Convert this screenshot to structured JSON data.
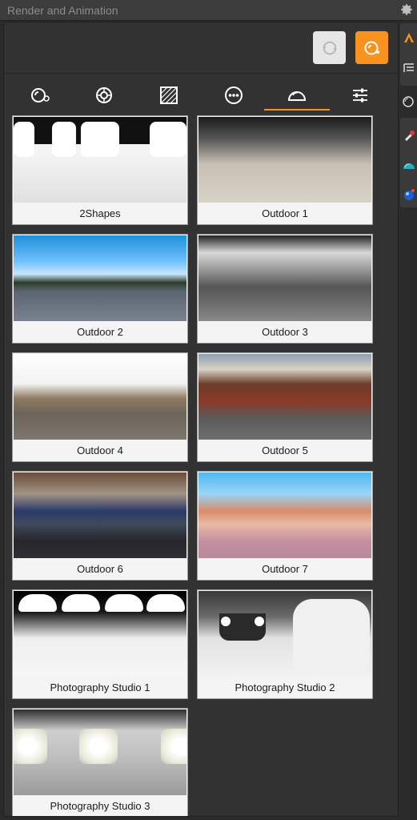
{
  "window": {
    "title": "Render and Animation"
  },
  "presets": [
    {
      "label": "2Shapes"
    },
    {
      "label": "Outdoor 1"
    },
    {
      "label": "Outdoor 2"
    },
    {
      "label": "Outdoor 3"
    },
    {
      "label": "Outdoor 4"
    },
    {
      "label": "Outdoor 5"
    },
    {
      "label": "Outdoor 6"
    },
    {
      "label": "Outdoor 7"
    },
    {
      "label": "Photography Studio 1"
    },
    {
      "label": "Photography Studio 2"
    },
    {
      "label": "Photography Studio 3"
    }
  ],
  "tabs": [
    {
      "icon": "render-settings-icon"
    },
    {
      "icon": "lens-icon"
    },
    {
      "icon": "texture-icon"
    },
    {
      "icon": "more-icon"
    },
    {
      "icon": "environment-icon",
      "active": true
    },
    {
      "icon": "sliders-icon"
    }
  ],
  "colors": {
    "accent": "#f7931e",
    "panel": "#323232",
    "background": "#2b2b2b"
  }
}
